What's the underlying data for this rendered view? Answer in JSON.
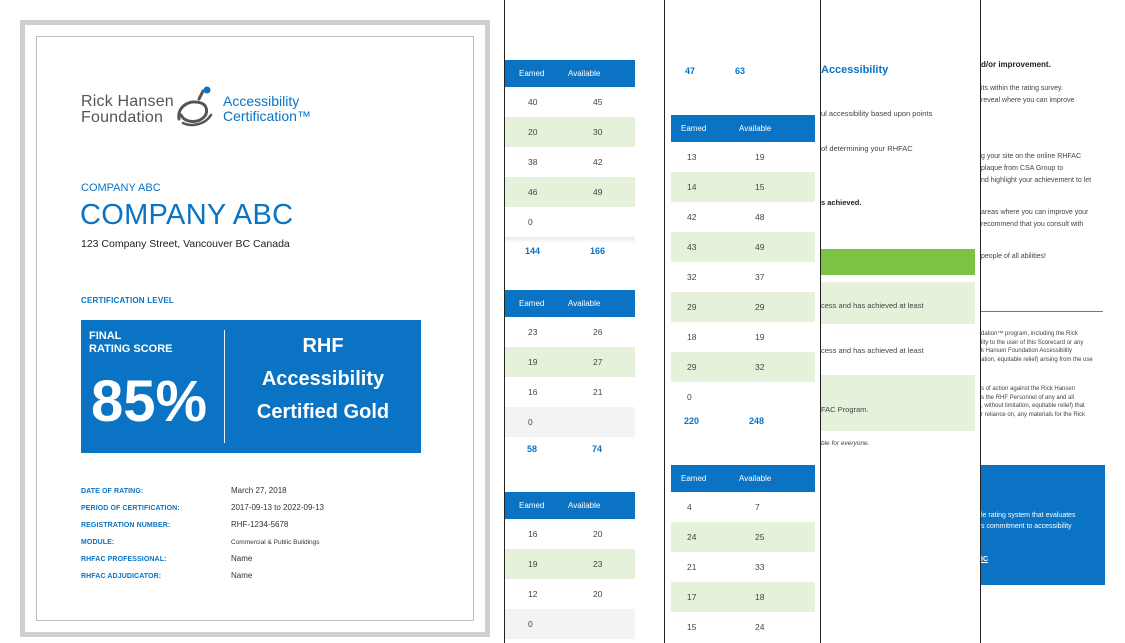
{
  "cover": {
    "logo_foundation_line1": "Rick Hansen",
    "logo_foundation_line2": "Foundation",
    "logo_cert_line1": "Accessibility",
    "logo_cert_line2": "Certification™",
    "company_small": "COMPANY ABC",
    "company_big": "COMPANY ABC",
    "address": "123 Company Street, Vancouver BC Canada",
    "cert_level_label": "CERTIFICATION LEVEL",
    "final_label_line1": "FINAL",
    "final_label_line2": "RATING SCORE",
    "score": "85%",
    "award_line1": "RHF",
    "award_line2": "Accessibility",
    "award_line3": "Certified Gold",
    "details": [
      {
        "label": "DATE OF RATING:",
        "value": "March 27, 2018"
      },
      {
        "label": "PERIOD OF CERTIFICATION:",
        "value": "2017-09-13 to 2022-09-13"
      },
      {
        "label": "REGISTRATION NUMBER:",
        "value": "RHF-1234-5678"
      },
      {
        "label": "MODULE:",
        "value": "Commercial & Public Buildings"
      },
      {
        "label": "RHFAC PROFESSIONAL:",
        "value": "Name"
      },
      {
        "label": "RHFAC ADJUDICATOR:",
        "value": "Name"
      }
    ],
    "colors": {
      "brand_blue": "#0a73c4",
      "row_green": "#e6f1dc",
      "accent_green": "#7cc244"
    }
  },
  "page2": {
    "col_earned": "Eamed",
    "col_available": "Available",
    "table1": {
      "rows": [
        [
          "40",
          "45"
        ],
        [
          "20",
          "30"
        ],
        [
          "38",
          "42"
        ],
        [
          "46",
          "49"
        ],
        [
          "0",
          ""
        ]
      ],
      "total": [
        "144",
        "166"
      ]
    },
    "table2": {
      "rows": [
        [
          "23",
          "26"
        ],
        [
          "19",
          "27"
        ],
        [
          "16",
          "21"
        ],
        [
          "0",
          ""
        ]
      ],
      "total": [
        "58",
        "74"
      ]
    },
    "table3": {
      "rows": [
        [
          "16",
          "20"
        ],
        [
          "19",
          "23"
        ],
        [
          "12",
          "20"
        ],
        [
          "0",
          ""
        ]
      ]
    }
  },
  "page3": {
    "col_earned": "Eamed",
    "col_available": "Available",
    "top_total": [
      "47",
      "63"
    ],
    "table1": {
      "rows": [
        [
          "13",
          "19"
        ],
        [
          "14",
          "15"
        ],
        [
          "42",
          "48"
        ],
        [
          "43",
          "49"
        ],
        [
          "32",
          "37"
        ],
        [
          "29",
          "29"
        ],
        [
          "18",
          "19"
        ],
        [
          "29",
          "32"
        ],
        [
          "0",
          ""
        ]
      ],
      "total": [
        "220",
        "248"
      ]
    },
    "table2": {
      "rows": [
        [
          "4",
          "7"
        ],
        [
          "24",
          "25"
        ],
        [
          "21",
          "33"
        ],
        [
          "17",
          "18"
        ],
        [
          "15",
          "24"
        ]
      ]
    }
  },
  "page4": {
    "title": "Accessibility",
    "line1": "ul accessibility based upon points",
    "line2": "of determining your RHFAC",
    "line3": "s achieved.",
    "box1": "cess and has achieved at least",
    "box2": "cess and has achieved at least",
    "box3": "FAC Program.",
    "footer": "ble for everyone."
  },
  "page5": {
    "heading": "d/or improvement.",
    "p1a": "its within the rating survey.",
    "p1b": "reveal where you can improve",
    "p2a": "g your site on the online RHFAC",
    "p2b": "plaque from CSA Group to",
    "p2c": "nd highlight your achievement to let",
    "p3a": "areas where you can improve your",
    "p3b": "recommend that you consult with",
    "p4": "people of all abilities!",
    "legal1": [
      "dation™ program, including the Rick",
      "lity to the user of this Scorecard or any",
      "k Hansen Foundation Accessibility",
      "ation, equitable relief) arising from the use"
    ],
    "legal2": [
      "s of action against the Rick Hansen",
      "s the RHF Personnel of any and all",
      ", without limitation, equitable relief) that",
      "r reliance on, any materials for the Rick"
    ],
    "blue_a": "le rating system that evaluates",
    "blue_b": "s commitment to accessibility",
    "blue_link": "IC"
  }
}
